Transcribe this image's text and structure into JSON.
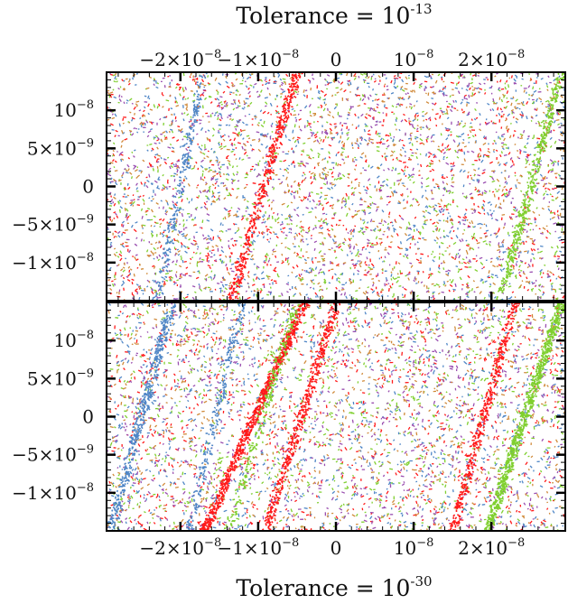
{
  "chart_data": [
    {
      "type": "scatter",
      "title": "Tolerance = 10",
      "title_exponent": "-13",
      "title_position": "top",
      "x_ticks": [
        {
          "value": -2e-08,
          "label": "−2×10",
          "exp": "−8"
        },
        {
          "value": -1e-08,
          "label": "−1×10",
          "exp": "−8"
        },
        {
          "value": 0,
          "label": "0",
          "exp": ""
        },
        {
          "value": 1e-08,
          "label": "10",
          "exp": "−8"
        },
        {
          "value": 2e-08,
          "label": "2×10",
          "exp": "−8"
        }
      ],
      "y_ticks": [
        {
          "value": 1e-08,
          "label": "10",
          "exp": "−8"
        },
        {
          "value": 5e-09,
          "label": "5×10",
          "exp": "−9"
        },
        {
          "value": 0,
          "label": "0",
          "exp": ""
        },
        {
          "value": -5e-09,
          "label": "−5×10",
          "exp": "−9"
        },
        {
          "value": -1e-08,
          "label": "−1×10",
          "exp": "−8"
        }
      ],
      "xlim": [
        -2.95e-08,
        2.95e-08
      ],
      "ylim": [
        -1.5e-08,
        1.5e-08
      ],
      "series_colors": [
        "#ff1a1a",
        "#7fcf2f",
        "#4f86c6",
        "#9a4fb0",
        "#d08a3a"
      ],
      "stripes": [
        {
          "color": "#ff1a1a",
          "x_at_bottom": -1.35e-08,
          "x_at_top": -5e-09,
          "density": "medium"
        },
        {
          "color": "#7fcf2f",
          "x_at_bottom": 2.1e-08,
          "x_at_top": 2.9e-08,
          "density": "medium"
        },
        {
          "color": "#4f86c6",
          "x_at_bottom": -2.3e-08,
          "x_at_top": -1.7e-08,
          "density": "low"
        }
      ]
    },
    {
      "type": "scatter",
      "title": "Tolerance = 10",
      "title_exponent": "-30",
      "title_position": "bottom",
      "x_ticks": [
        {
          "value": -2e-08,
          "label": "−2×10",
          "exp": "−8"
        },
        {
          "value": -1e-08,
          "label": "−1×10",
          "exp": "−8"
        },
        {
          "value": 0,
          "label": "0",
          "exp": ""
        },
        {
          "value": 1e-08,
          "label": "10",
          "exp": "−8"
        },
        {
          "value": 2e-08,
          "label": "2×10",
          "exp": "−8"
        }
      ],
      "y_ticks": [
        {
          "value": 1e-08,
          "label": "10",
          "exp": "−8"
        },
        {
          "value": 5e-09,
          "label": "5×10",
          "exp": "−9"
        },
        {
          "value": 0,
          "label": "0",
          "exp": ""
        },
        {
          "value": -5e-09,
          "label": "−5×10",
          "exp": "−9"
        },
        {
          "value": -1e-08,
          "label": "−1×10",
          "exp": "−8"
        }
      ],
      "xlim": [
        -2.95e-08,
        2.95e-08
      ],
      "ylim": [
        -1.5e-08,
        1.5e-08
      ],
      "series_colors": [
        "#ff1a1a",
        "#7fcf2f",
        "#4f86c6",
        "#9a4fb0",
        "#d08a3a"
      ],
      "stripes": [
        {
          "color": "#ff1a1a",
          "x_at_bottom": -1.7e-08,
          "x_at_top": -4e-09,
          "density": "high"
        },
        {
          "color": "#ff1a1a",
          "x_at_bottom": -9e-09,
          "x_at_top": 1e-10,
          "density": "medium"
        },
        {
          "color": "#ff1a1a",
          "x_at_bottom": 1.5e-08,
          "x_at_top": 2.3e-08,
          "density": "medium"
        },
        {
          "color": "#7fcf2f",
          "x_at_bottom": 1.95e-08,
          "x_at_top": 2.9e-08,
          "density": "high"
        },
        {
          "color": "#4f86c6",
          "x_at_bottom": -2.9e-08,
          "x_at_top": -2.1e-08,
          "density": "medium"
        },
        {
          "color": "#4f86c6",
          "x_at_bottom": -1.9e-08,
          "x_at_top": -1.2e-08,
          "density": "low"
        },
        {
          "color": "#7fcf2f",
          "x_at_bottom": -1.4e-08,
          "x_at_top": -5e-09,
          "density": "low"
        }
      ]
    }
  ]
}
